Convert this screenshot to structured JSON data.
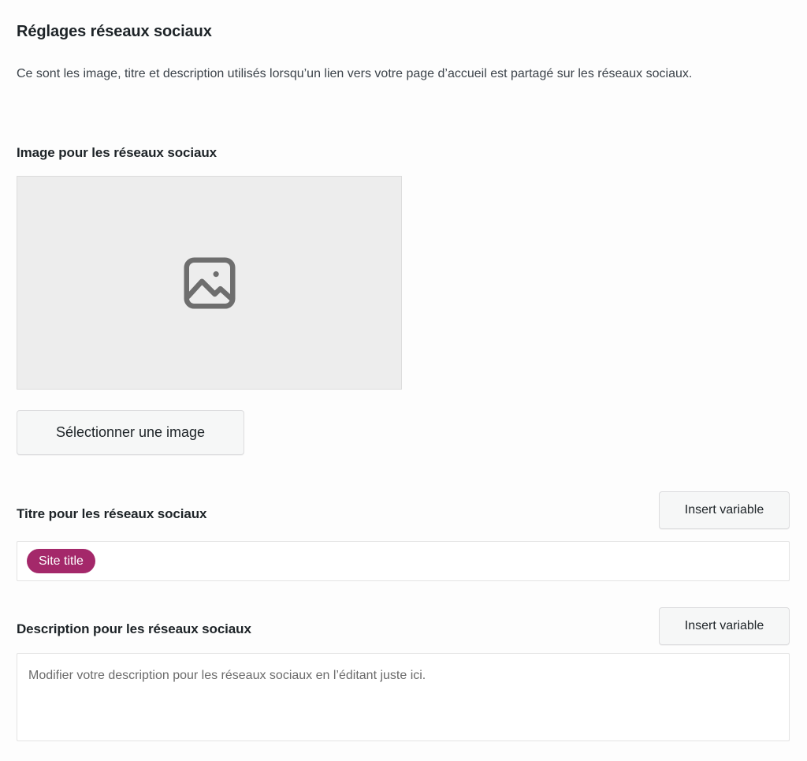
{
  "section": {
    "title": "Réglages réseaux sociaux",
    "intro": "Ce sont les image, titre et description utilisés lorsqu’un lien vers votre page d’accueil est partagé sur les réseaux sociaux."
  },
  "image_field": {
    "label": "Image pour les réseaux sociaux",
    "placeholder_icon": "image-placeholder-icon",
    "select_button_label": "Sélectionner une image"
  },
  "title_field": {
    "label": "Titre pour les réseaux sociaux",
    "insert_variable_label": "Insert variable",
    "tag_value": "Site title"
  },
  "description_field": {
    "label": "Description pour les réseaux sociaux",
    "insert_variable_label": "Insert variable",
    "placeholder": "Modifier votre description pour les réseaux sociaux en l’éditant juste ici."
  },
  "colors": {
    "page_background": "#fdfdfd",
    "dropzone_background": "#ededed",
    "dropzone_border": "#dcdcdc",
    "tag_background": "#a4286a",
    "button_background": "#f6f7f7",
    "button_border": "#dcdcde",
    "heading_text": "#1d2327",
    "body_text": "#3c434a",
    "placeholder_text": "#6b6b6b",
    "icon_gray": "#6e6e6e"
  }
}
